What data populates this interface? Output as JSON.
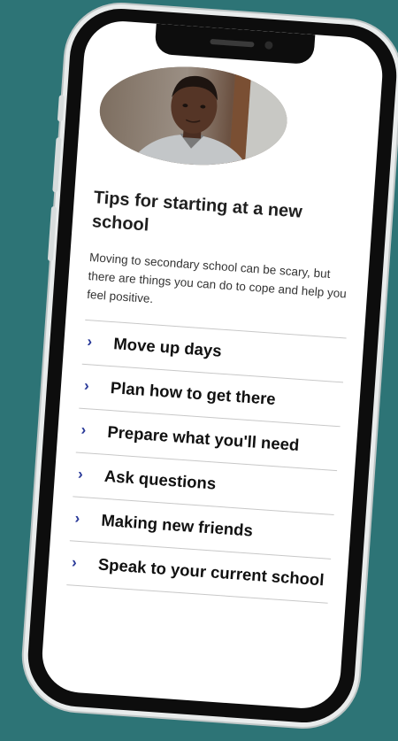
{
  "colors": {
    "background": "#2d7476",
    "phone_frame": "#0d0d0d",
    "chevron": "#2a3a99",
    "text": "#111111"
  },
  "photo": {
    "subject": "child portrait photo"
  },
  "article": {
    "title": "Tips for starting at a new school",
    "intro": "Moving to secondary school can be scary, but there are things you can do to cope and help you feel positive."
  },
  "tips": [
    {
      "label": "Move up days",
      "icon": "chevron-right-icon"
    },
    {
      "label": "Plan how to get there",
      "icon": "chevron-right-icon"
    },
    {
      "label": "Prepare what you'll need",
      "icon": "chevron-right-icon"
    },
    {
      "label": "Ask questions",
      "icon": "chevron-right-icon"
    },
    {
      "label": "Making new friends",
      "icon": "chevron-right-icon"
    },
    {
      "label": "Speak to your current school",
      "icon": "chevron-right-icon"
    }
  ]
}
